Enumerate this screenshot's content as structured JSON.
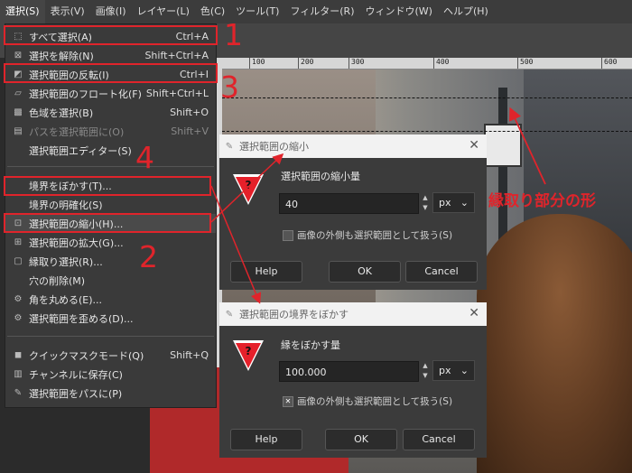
{
  "menubar": {
    "items": [
      "選択(S)",
      "表示(V)",
      "画像(I)",
      "レイヤー(L)",
      "色(C)",
      "ツール(T)",
      "フィルター(R)",
      "ウィンドウ(W)",
      "ヘルプ(H)"
    ]
  },
  "ruler": {
    "ticks": [
      "100",
      "200",
      "300",
      "400",
      "500",
      "600"
    ]
  },
  "select_menu": {
    "items": [
      {
        "label": "すべて選択(A)",
        "shortcut": "Ctrl+A",
        "icon": "select-all-icon",
        "glyph": "⬚"
      },
      {
        "label": "選択を解除(N)",
        "shortcut": "Shift+Ctrl+A",
        "icon": "select-none-icon",
        "glyph": "⊠"
      },
      {
        "label": "選択範囲の反転(I)",
        "shortcut": "Ctrl+I",
        "icon": "invert-selection-icon",
        "glyph": "◩"
      },
      {
        "label": "選択範囲のフロート化(F)",
        "shortcut": "Shift+Ctrl+L",
        "icon": "float-selection-icon",
        "glyph": "▱"
      },
      {
        "label": "色域を選択(B)",
        "shortcut": "Shift+O",
        "icon": "by-color-select-icon",
        "glyph": "▩"
      },
      {
        "label": "パスを選択範囲に(O)",
        "shortcut": "Shift+V",
        "icon": "path-to-selection-icon",
        "glyph": "▤"
      },
      {
        "label": "選択範囲エディター(S)",
        "shortcut": "",
        "icon": "selection-editor-icon",
        "glyph": ""
      },
      {
        "label": "境界をぼかす(T)...",
        "shortcut": "",
        "icon": "feather-icon",
        "glyph": ""
      },
      {
        "label": "境界の明確化(S)",
        "shortcut": "",
        "icon": "sharpen-icon",
        "glyph": ""
      },
      {
        "label": "選択範囲の縮小(H)...",
        "shortcut": "",
        "icon": "shrink-selection-icon",
        "glyph": "⊡"
      },
      {
        "label": "選択範囲の拡大(G)...",
        "shortcut": "",
        "icon": "grow-selection-icon",
        "glyph": "⊞"
      },
      {
        "label": "縁取り選択(R)...",
        "shortcut": "",
        "icon": "border-selection-icon",
        "glyph": "▢"
      },
      {
        "label": "穴の削除(M)",
        "shortcut": "",
        "icon": "remove-holes-icon",
        "glyph": ""
      },
      {
        "label": "角を丸める(E)...",
        "shortcut": "",
        "icon": "rounded-rectangle-icon",
        "glyph": "⚙"
      },
      {
        "label": "選択範囲を歪める(D)...",
        "shortcut": "",
        "icon": "distort-selection-icon",
        "glyph": "⚙"
      },
      {
        "label": "クイックマスクモード(Q)",
        "shortcut": "Shift+Q",
        "icon": "quick-mask-icon",
        "glyph": "◼"
      },
      {
        "label": "チャンネルに保存(C)",
        "shortcut": "",
        "icon": "save-to-channel-icon",
        "glyph": "▥"
      },
      {
        "label": "選択範囲をパスに(P)",
        "shortcut": "",
        "icon": "selection-to-path-icon",
        "glyph": "✎"
      }
    ]
  },
  "annotations": {
    "numbers": [
      "1",
      "2",
      "3",
      "4"
    ],
    "border_label": "縁取り部分の形",
    "color": "#e0242b"
  },
  "shrink_dialog": {
    "title": "選択範囲の縮小",
    "label": "選択範囲の縮小量",
    "value": "40",
    "unit": "px",
    "checkbox_label": "画像の外側も選択範囲として扱う(S)",
    "checkbox_checked": false,
    "help": "Help",
    "ok": "OK",
    "cancel": "Cancel"
  },
  "feather_dialog": {
    "title": "選択範囲の境界をぼかす",
    "label": "縁をぼかす量",
    "value": "100.000",
    "unit": "px",
    "checkbox_label": "画像の外側も選択範囲として扱う(S)",
    "checkbox_checked": true,
    "help": "Help",
    "ok": "OK",
    "cancel": "Cancel"
  }
}
